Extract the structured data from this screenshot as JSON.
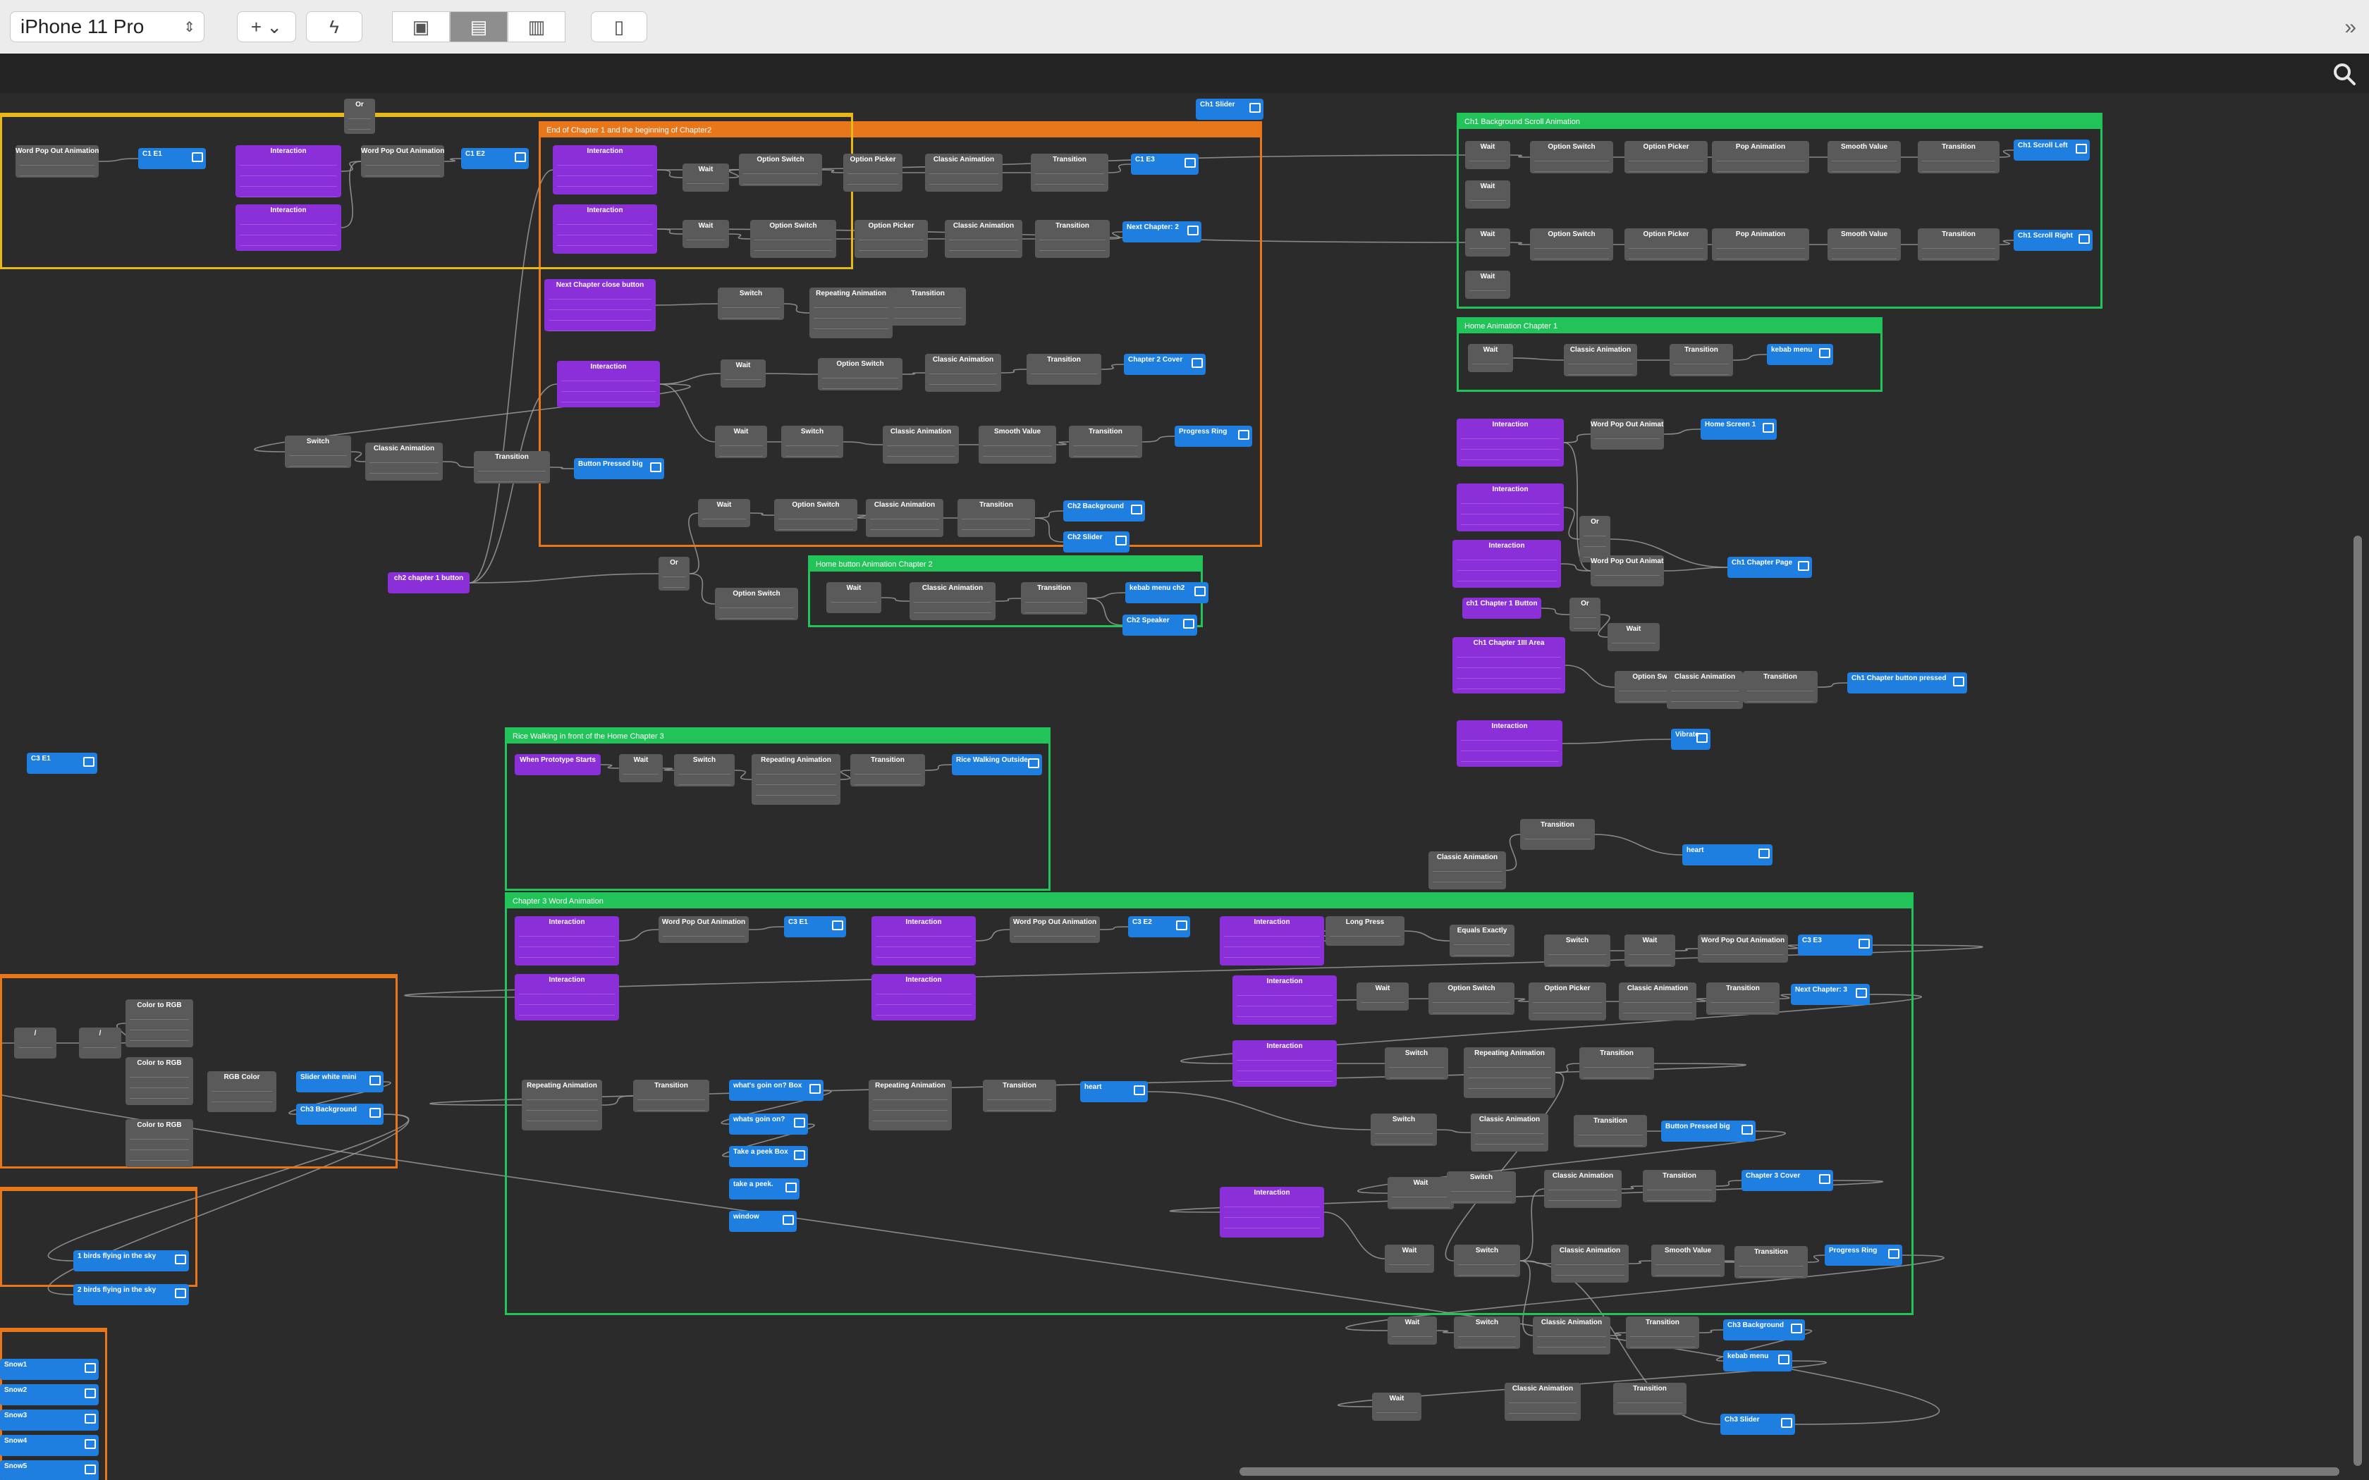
{
  "toolbar": {
    "device": "iPhone 11 Pro",
    "buttons": [
      "add-layer",
      "lightning",
      "layout-single",
      "layout-split",
      "layout-triple",
      "phone-preview",
      "expand"
    ]
  },
  "groups": [
    {
      "id": "g1",
      "title": "End of Chapter 1 and the beginning of Chapter2",
      "color": "orange"
    },
    {
      "id": "g2",
      "title": "Ch1 Background Scroll Animation",
      "color": "green"
    },
    {
      "id": "g3",
      "title": "Home Animation Chapter 1",
      "color": "green"
    },
    {
      "id": "g4",
      "title": "Home button Animation Chapter 2",
      "color": "green"
    },
    {
      "id": "g5",
      "title": "Rice Walking in front of the Home Chapter 3",
      "color": "green"
    },
    {
      "id": "g6",
      "title": "Chapter 3 Word Animation",
      "color": "green"
    }
  ],
  "nodes": [
    {
      "t": "Word Pop Out Animation",
      "c": "gray"
    },
    {
      "t": "C1 E1",
      "c": "blue"
    },
    {
      "t": "Interaction",
      "c": "purple"
    },
    {
      "t": "Word Pop Out Animation",
      "c": "gray"
    },
    {
      "t": "C1 E2",
      "c": "blue"
    },
    {
      "t": "Interaction",
      "c": "purple"
    },
    {
      "t": "Or",
      "c": "gray"
    },
    {
      "t": "Ch1 Slider",
      "c": "blue"
    },
    {
      "t": "Interaction",
      "c": "purple"
    },
    {
      "t": "Wait",
      "c": "gray"
    },
    {
      "t": "Option Switch",
      "c": "gray"
    },
    {
      "t": "Option Picker",
      "c": "gray"
    },
    {
      "t": "Classic Animation",
      "c": "gray"
    },
    {
      "t": "Transition",
      "c": "gray"
    },
    {
      "t": "C1 E3",
      "c": "blue"
    },
    {
      "t": "Interaction",
      "c": "purple"
    },
    {
      "t": "Wait",
      "c": "gray"
    },
    {
      "t": "Option Switch",
      "c": "gray"
    },
    {
      "t": "Option Picker",
      "c": "gray"
    },
    {
      "t": "Classic Animation",
      "c": "gray"
    },
    {
      "t": "Transition",
      "c": "gray"
    },
    {
      "t": "Next Chapter: 2",
      "c": "blue"
    },
    {
      "t": "Next Chapter close button",
      "c": "purple"
    },
    {
      "t": "Switch",
      "c": "gray"
    },
    {
      "t": "Repeating Animation",
      "c": "gray"
    },
    {
      "t": "Transition",
      "c": "gray"
    },
    {
      "t": "Interaction",
      "c": "purple"
    },
    {
      "t": "Wait",
      "c": "gray"
    },
    {
      "t": "Option Switch",
      "c": "gray"
    },
    {
      "t": "Classic Animation",
      "c": "gray"
    },
    {
      "t": "Transition",
      "c": "gray"
    },
    {
      "t": "Chapter 2 Cover",
      "c": "blue"
    },
    {
      "t": "Switch",
      "c": "gray"
    },
    {
      "t": "Classic Animation",
      "c": "gray"
    },
    {
      "t": "Transition",
      "c": "gray"
    },
    {
      "t": "Button Pressed big",
      "c": "blue"
    },
    {
      "t": "Wait",
      "c": "gray"
    },
    {
      "t": "Switch",
      "c": "gray"
    },
    {
      "t": "Classic Animation",
      "c": "gray"
    },
    {
      "t": "Smooth Value",
      "c": "gray"
    },
    {
      "t": "Transition",
      "c": "gray"
    },
    {
      "t": "Progress Ring",
      "c": "blue"
    },
    {
      "t": "Wait",
      "c": "gray"
    },
    {
      "t": "Option Switch",
      "c": "gray"
    },
    {
      "t": "Classic Animation",
      "c": "gray"
    },
    {
      "t": "Transition",
      "c": "gray"
    },
    {
      "t": "Ch2 Background",
      "c": "blue"
    },
    {
      "t": "Ch2 Slider",
      "c": "blue"
    },
    {
      "t": "ch2 chapter 1 button",
      "c": "purple"
    },
    {
      "t": "Or",
      "c": "gray"
    },
    {
      "t": "Option Switch",
      "c": "gray"
    },
    {
      "t": "Wait",
      "c": "gray"
    },
    {
      "t": "Classic Animation",
      "c": "gray"
    },
    {
      "t": "Transition",
      "c": "gray"
    },
    {
      "t": "kebab menu ch2",
      "c": "blue"
    },
    {
      "t": "Ch2 Speaker",
      "c": "blue"
    },
    {
      "t": "Wait",
      "c": "gray"
    },
    {
      "t": "Option Switch",
      "c": "gray"
    },
    {
      "t": "Option Picker",
      "c": "gray"
    },
    {
      "t": "Pop Animation",
      "c": "gray"
    },
    {
      "t": "Smooth Value",
      "c": "gray"
    },
    {
      "t": "Transition",
      "c": "gray"
    },
    {
      "t": "Ch1 Scroll Left",
      "c": "blue"
    },
    {
      "t": "Wait",
      "c": "gray"
    },
    {
      "t": "Wait",
      "c": "gray"
    },
    {
      "t": "Option Switch",
      "c": "gray"
    },
    {
      "t": "Option Picker",
      "c": "gray"
    },
    {
      "t": "Pop Animation",
      "c": "gray"
    },
    {
      "t": "Smooth Value",
      "c": "gray"
    },
    {
      "t": "Transition",
      "c": "gray"
    },
    {
      "t": "Ch1 Scroll Right",
      "c": "blue"
    },
    {
      "t": "Wait",
      "c": "gray"
    },
    {
      "t": "Wait",
      "c": "gray"
    },
    {
      "t": "Classic Animation",
      "c": "gray"
    },
    {
      "t": "Transition",
      "c": "gray"
    },
    {
      "t": "kebab menu",
      "c": "blue"
    },
    {
      "t": "Interaction",
      "c": "purple"
    },
    {
      "t": "Word Pop Out Animation",
      "c": "gray"
    },
    {
      "t": "Home Screen 1",
      "c": "blue"
    },
    {
      "t": "Interaction",
      "c": "purple"
    },
    {
      "t": "Or",
      "c": "gray"
    },
    {
      "t": "Interaction",
      "c": "purple"
    },
    {
      "t": "Word Pop Out Animation",
      "c": "gray"
    },
    {
      "t": "Ch1 Chapter Page",
      "c": "blue"
    },
    {
      "t": "ch1 Chapter 1 Button",
      "c": "purple"
    },
    {
      "t": "Or",
      "c": "gray"
    },
    {
      "t": "Wait",
      "c": "gray"
    },
    {
      "t": "Ch1 Chapter 1III Area",
      "c": "purple"
    },
    {
      "t": "Option Switch",
      "c": "gray"
    },
    {
      "t": "Classic Animation",
      "c": "gray"
    },
    {
      "t": "Transition",
      "c": "gray"
    },
    {
      "t": "Ch1 Chapter button pressed",
      "c": "blue"
    },
    {
      "t": "Interaction",
      "c": "purple"
    },
    {
      "t": "Vibrate",
      "c": "blue"
    },
    {
      "t": "C3 E1",
      "c": "blue"
    },
    {
      "t": "When Prototype Starts",
      "c": "purple"
    },
    {
      "t": "Wait",
      "c": "gray"
    },
    {
      "t": "Switch",
      "c": "gray"
    },
    {
      "t": "Repeating Animation",
      "c": "gray"
    },
    {
      "t": "Transition",
      "c": "gray"
    },
    {
      "t": "Rice Walking Outside",
      "c": "blue"
    },
    {
      "t": "Transition",
      "c": "gray"
    },
    {
      "t": "Classic Animation",
      "c": "gray"
    },
    {
      "t": "heart",
      "c": "blue"
    },
    {
      "t": "Interaction",
      "c": "purple"
    },
    {
      "t": "Word Pop Out Animation",
      "c": "gray"
    },
    {
      "t": "C3 E1",
      "c": "blue"
    },
    {
      "t": "Interaction",
      "c": "purple"
    },
    {
      "t": "Word Pop Out Animation",
      "c": "gray"
    },
    {
      "t": "C3 E2",
      "c": "blue"
    },
    {
      "t": "Interaction",
      "c": "purple"
    },
    {
      "t": "Long Press",
      "c": "gray"
    },
    {
      "t": "Equals Exactly",
      "c": "gray"
    },
    {
      "t": "Switch",
      "c": "gray"
    },
    {
      "t": "Wait",
      "c": "gray"
    },
    {
      "t": "Word Pop Out Animation",
      "c": "gray"
    },
    {
      "t": "C3 E3",
      "c": "blue"
    },
    {
      "t": "Interaction",
      "c": "purple"
    },
    {
      "t": "Interaction",
      "c": "purple"
    },
    {
      "t": "Interaction",
      "c": "purple"
    },
    {
      "t": "Wait",
      "c": "gray"
    },
    {
      "t": "Option Switch",
      "c": "gray"
    },
    {
      "t": "Option Picker",
      "c": "gray"
    },
    {
      "t": "Classic Animation",
      "c": "gray"
    },
    {
      "t": "Transition",
      "c": "gray"
    },
    {
      "t": "Next Chapter: 3",
      "c": "blue"
    },
    {
      "t": "Interaction",
      "c": "purple"
    },
    {
      "t": "Switch",
      "c": "gray"
    },
    {
      "t": "Repeating Animation",
      "c": "gray"
    },
    {
      "t": "Transition",
      "c": "gray"
    },
    {
      "t": "Repeating Animation",
      "c": "gray"
    },
    {
      "t": "Transition",
      "c": "gray"
    },
    {
      "t": "what's goin on? Box",
      "c": "blue"
    },
    {
      "t": "whats goin on?",
      "c": "blue"
    },
    {
      "t": "Take a peek Box",
      "c": "blue"
    },
    {
      "t": "take a peek.",
      "c": "blue"
    },
    {
      "t": "window",
      "c": "blue"
    },
    {
      "t": "Repeating Animation",
      "c": "gray"
    },
    {
      "t": "Transition",
      "c": "gray"
    },
    {
      "t": "heart",
      "c": "blue"
    },
    {
      "t": "Switch",
      "c": "gray"
    },
    {
      "t": "Classic Animation",
      "c": "gray"
    },
    {
      "t": "Transition",
      "c": "gray"
    },
    {
      "t": "Button Pressed big",
      "c": "blue"
    },
    {
      "t": "Wait",
      "c": "gray"
    },
    {
      "t": "Switch",
      "c": "gray"
    },
    {
      "t": "Classic Animation",
      "c": "gray"
    },
    {
      "t": "Transition",
      "c": "gray"
    },
    {
      "t": "Chapter 3 Cover",
      "c": "blue"
    },
    {
      "t": "Interaction",
      "c": "purple"
    },
    {
      "t": "Wait",
      "c": "gray"
    },
    {
      "t": "Switch",
      "c": "gray"
    },
    {
      "t": "Classic Animation",
      "c": "gray"
    },
    {
      "t": "Smooth Value",
      "c": "gray"
    },
    {
      "t": "Transition",
      "c": "gray"
    },
    {
      "t": "Progress Ring",
      "c": "blue"
    },
    {
      "t": "Wait",
      "c": "gray"
    },
    {
      "t": "Switch",
      "c": "gray"
    },
    {
      "t": "Classic Animation",
      "c": "gray"
    },
    {
      "t": "Transition",
      "c": "gray"
    },
    {
      "t": "Ch3 Background",
      "c": "blue"
    },
    {
      "t": "kebab menu",
      "c": "blue"
    },
    {
      "t": "Wait",
      "c": "gray"
    },
    {
      "t": "Classic Animation",
      "c": "gray"
    },
    {
      "t": "Transition",
      "c": "gray"
    },
    {
      "t": "Ch3 Slider",
      "c": "blue"
    },
    {
      "t": "/",
      "c": "gray"
    },
    {
      "t": "/",
      "c": "gray"
    },
    {
      "t": "Color to RGB",
      "c": "gray"
    },
    {
      "t": "Color to RGB",
      "c": "gray"
    },
    {
      "t": "Color to RGB",
      "c": "gray"
    },
    {
      "t": "RGB Color",
      "c": "gray"
    },
    {
      "t": "Slider white mini",
      "c": "blue"
    },
    {
      "t": "Ch3 Background",
      "c": "blue"
    },
    {
      "t": "1 birds flying in the sky",
      "c": "blue"
    },
    {
      "t": "2 birds flying in the sky",
      "c": "blue"
    },
    {
      "t": "Snow1",
      "c": "blue"
    },
    {
      "t": "Snow2",
      "c": "blue"
    },
    {
      "t": "Snow3",
      "c": "blue"
    },
    {
      "t": "Snow4",
      "c": "blue"
    },
    {
      "t": "Snow5",
      "c": "blue"
    }
  ],
  "colors": {
    "green": "#22c45a",
    "orange": "#e8761a",
    "yellow": "#e8b818",
    "purple": "#8b2fd8",
    "blue": "#1e7fe0",
    "gray": "#5a5a5a",
    "wire": "#9a9a9a"
  }
}
